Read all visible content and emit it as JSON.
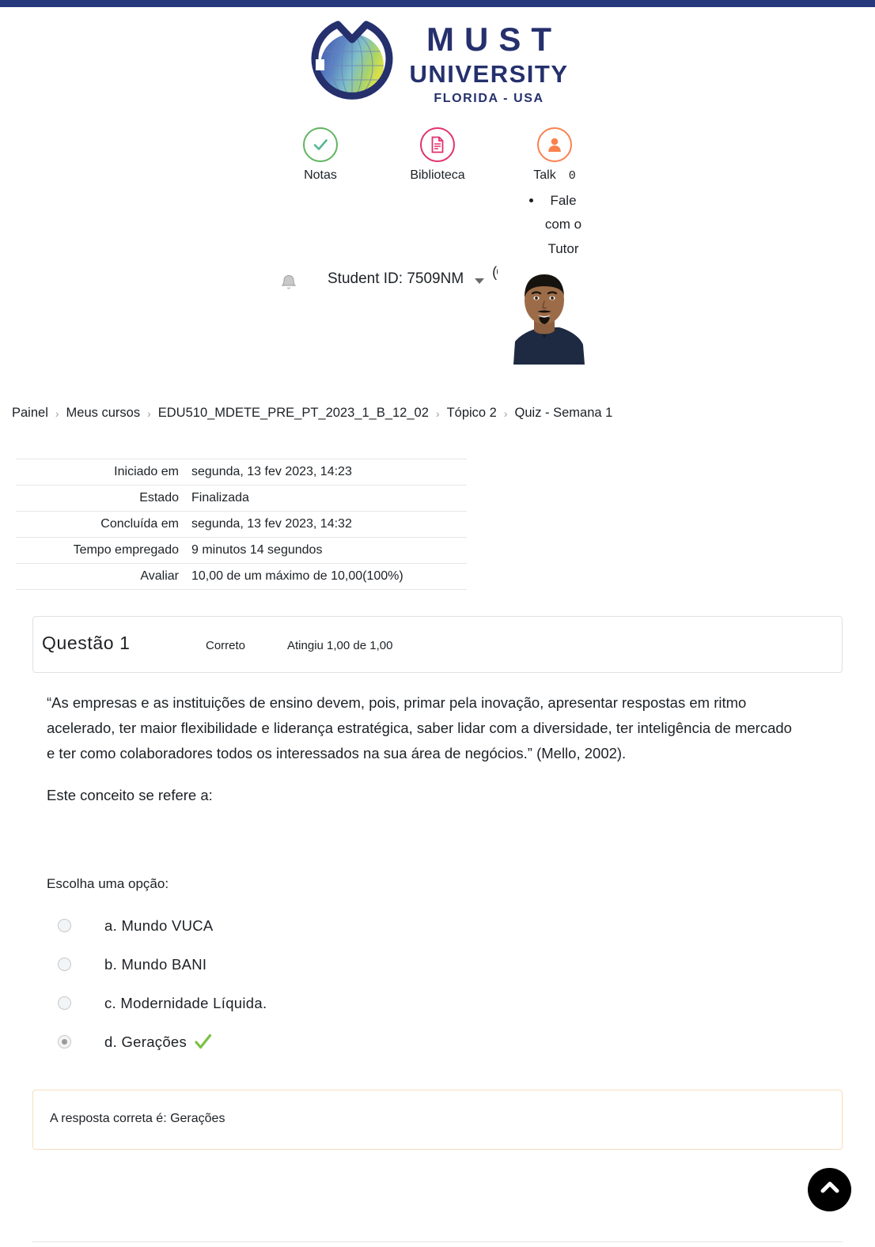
{
  "theme": {
    "topbar_color": "#27397d",
    "brand_navy": "#25306d",
    "green": "#5fb55f",
    "pink": "#e2316f",
    "orange": "#f9814e",
    "check_green": "#7ac143",
    "feedback_border": "#f6dfc0"
  },
  "logo": {
    "line1": "MUST",
    "line2": "UNIVERSITY",
    "line3": "FLORIDA - USA",
    "globe_icon": "globe-icon"
  },
  "quick_icons": [
    {
      "label": "Notas",
      "icon": "check-circle-icon"
    },
    {
      "label": "Biblioteca",
      "icon": "document-icon"
    },
    {
      "label": "Talk",
      "icon": "person-icon",
      "badge": "0"
    }
  ],
  "tutor": {
    "item": "Fale com o Tutor"
  },
  "user": {
    "bell_icon": "bell-icon",
    "student_id": "Student ID: 7509NM",
    "caret_icon": "chevron-down-icon",
    "name_fragment": "(C",
    "avatar_icon": "user-avatar-photo"
  },
  "breadcrumb": {
    "items": [
      "Painel",
      "Meus cursos",
      "EDU510_MDETE_PRE_PT_2023_1_B_12_02",
      "Tópico 2",
      "Quiz - Semana 1"
    ],
    "separator": "›"
  },
  "summary": {
    "rows": [
      {
        "key": "Iniciado em",
        "value": "segunda, 13 fev 2023, 14:23"
      },
      {
        "key": "Estado",
        "value": "Finalizada"
      },
      {
        "key": "Concluída em",
        "value": "segunda, 13 fev 2023, 14:32"
      },
      {
        "key": "Tempo empregado",
        "value": "9 minutos 14 segundos"
      },
      {
        "key": "Avaliar",
        "value": "10,00 de um máximo de 10,00(100%)"
      }
    ]
  },
  "question": {
    "number_label": "Questão 1",
    "state": "Correto",
    "grade": "Atingiu 1,00 de 1,00",
    "paragraph1": "“As empresas e as instituições de ensino devem, pois, primar pela inovação, apresentar respostas em ritmo acelerado, ter maior flexibilidade e liderança estratégica, saber lidar com a diversidade, ter inteligência de mercado e ter como colaboradores todos os interessados na sua área de negócios.” (Mello, 2002).",
    "paragraph2": "Este conceito se refere a:",
    "choose_label": "Escolha uma opção:",
    "options": [
      {
        "text": "a. Mundo VUCA",
        "selected": false,
        "correct_mark": false
      },
      {
        "text": "b. Mundo BANI",
        "selected": false,
        "correct_mark": false
      },
      {
        "text": "c. Modernidade Líquida.",
        "selected": false,
        "correct_mark": false
      },
      {
        "text": "d. Gerações",
        "selected": true,
        "correct_mark": true
      }
    ],
    "feedback": "A resposta correta é: Gerações"
  },
  "fab": {
    "icon": "chevron-up-icon"
  }
}
